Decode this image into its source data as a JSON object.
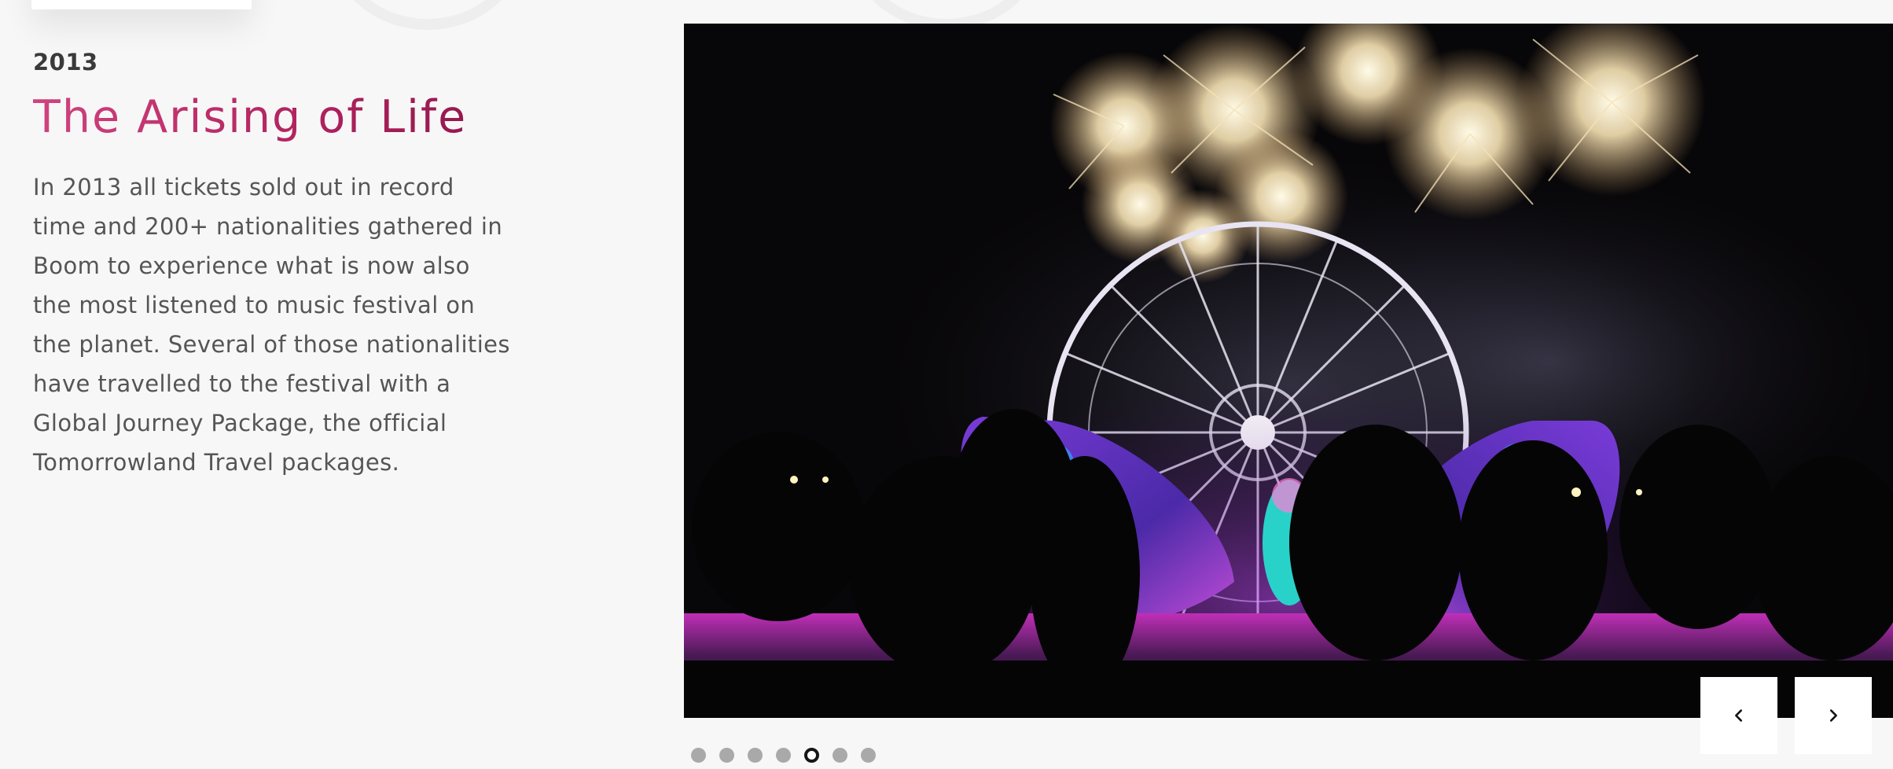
{
  "slide": {
    "year": "2013",
    "title": "The Arising of Life",
    "description_lines": [
      "In 2013 all tickets sold out in record",
      "time and 200+ nationalities gathered in",
      "Boom to experience what is now also",
      "the most listened to music festival on",
      "the planet. Several of those nationalities",
      "have travelled to the festival with a",
      "Global Journey Package, the official",
      "Tomorrowland Travel packages."
    ]
  },
  "photo": {
    "subject": "Night festival scene with fireworks above a Ferris wheel and a glowing butterfly stage"
  },
  "navigation": {
    "prev_icon": "chevron-left-icon",
    "next_icon": "chevron-right-icon"
  },
  "pagination": {
    "total": 7,
    "active_index": 4
  },
  "colors": {
    "title_gradient_start": "#d0447e",
    "title_gradient_end": "#8d1548",
    "background": "#f7f7f7",
    "dot_inactive": "#a9a9a9",
    "dot_active_border": "#151515"
  }
}
